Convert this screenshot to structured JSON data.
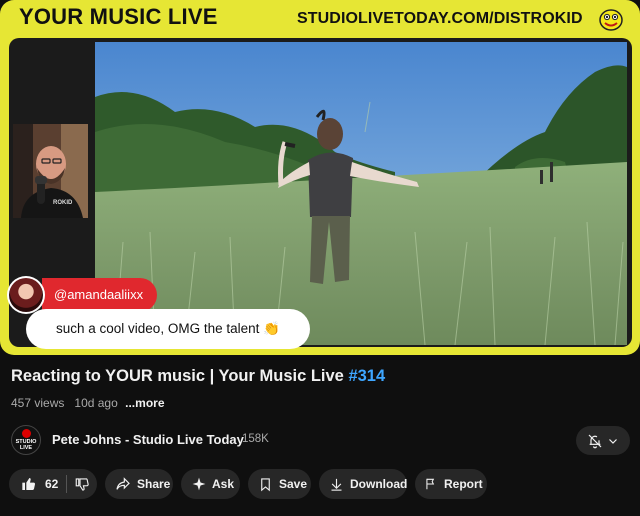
{
  "video": {
    "banner_left": "YOUR MUSIC LIVE",
    "banner_right": "STUDIOLIVETODAY.COM/DISTROKID",
    "webcam_mic_tag": "ROKID",
    "comment": {
      "username": "@amandaaliixx",
      "text": "such a cool video, OMG the talent 👏"
    },
    "colors": {
      "frame": "#e6e634",
      "comment_tag": "#e0282e"
    }
  },
  "info": {
    "title_main": "Reacting to YOUR music | Your Music Live ",
    "title_hashtag": "#314",
    "views": "457 views",
    "date": "10d ago",
    "more": "...more"
  },
  "channel": {
    "avatar_text_top": "STUDIO",
    "avatar_text_bottom": "LIVE",
    "name": "Pete Johns - Studio Live Today",
    "subscribers": "158K",
    "bell_icon": "bell-off-icon"
  },
  "actions": {
    "like_count": "62",
    "share": "Share",
    "ask": "Ask",
    "save": "Save",
    "download": "Download",
    "report": "Report"
  },
  "theme": {
    "accent": "#3ea6ff",
    "chip_bg": "#272727",
    "bg": "#0f0f0f"
  }
}
